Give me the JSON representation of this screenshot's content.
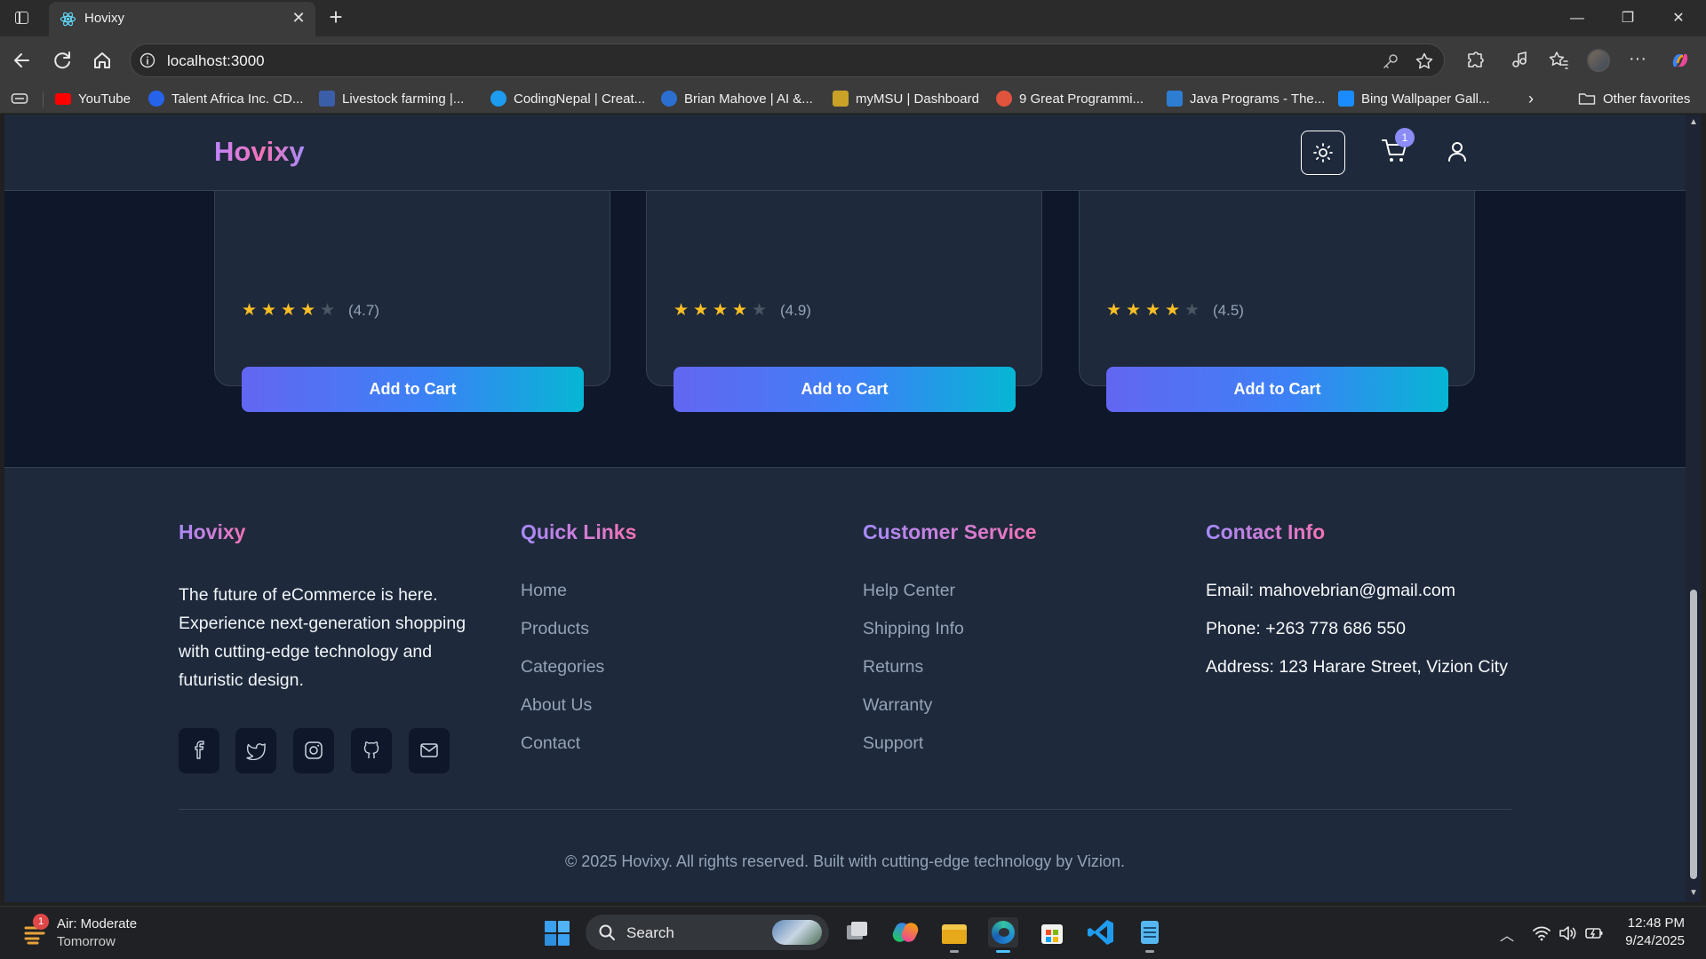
{
  "browser": {
    "tab_title": "Hovixy",
    "url": "localhost:3000",
    "window_controls": [
      "minimize",
      "restore",
      "close"
    ],
    "bookmarks": [
      {
        "label": "YouTube",
        "icon": "youtube-icon",
        "color": "#ff0000"
      },
      {
        "label": "Talent Africa Inc. CD...",
        "icon": "talent-africa-icon",
        "color": "#2563eb"
      },
      {
        "label": "Livestock farming |...",
        "icon": "livestock-icon",
        "color": "#3b5ea8"
      },
      {
        "label": "CodingNepal | Creat...",
        "icon": "codingnepal-icon",
        "color": "#1d9bf0"
      },
      {
        "label": "Brian Mahove | AI &...",
        "icon": "globe-icon",
        "color": "#2b6fd1"
      },
      {
        "label": "myMSU | Dashboard",
        "icon": "msu-icon",
        "color": "#c9a227"
      },
      {
        "label": "9 Great Programmi...",
        "icon": "programming-icon",
        "color": "#e0533c"
      },
      {
        "label": "Java Programs - The...",
        "icon": "java-icon",
        "color": "#2d7dd2"
      },
      {
        "label": "Bing Wallpaper Gall...",
        "icon": "bing-icon",
        "color": "#1a8cff"
      }
    ],
    "other_favorites": "Other favorites"
  },
  "site": {
    "brand": "Hovixy",
    "cart_count": "1",
    "products": [
      {
        "rating": "(4.7)",
        "stars": 4,
        "button": "Add to Cart"
      },
      {
        "rating": "(4.9)",
        "stars": 4,
        "button": "Add to Cart"
      },
      {
        "rating": "(4.5)",
        "stars": 4,
        "button": "Add to Cart"
      }
    ]
  },
  "footer": {
    "brand": "Hovixy",
    "description": "The future of eCommerce is here. Experience next-generation shopping with cutting-edge technology and futuristic design.",
    "quick_links_title": "Quick Links",
    "quick_links": [
      "Home",
      "Products",
      "Categories",
      "About Us",
      "Contact"
    ],
    "customer_service_title": "Customer Service",
    "customer_service": [
      "Help Center",
      "Shipping Info",
      "Returns",
      "Warranty",
      "Support"
    ],
    "contact_title": "Contact Info",
    "contact": {
      "email": "Email: mahovebrian@gmail.com",
      "phone": "Phone: +263 778 686 550",
      "address": "Address: 123 Harare Street, Vizion City"
    },
    "social_icons": [
      "facebook-icon",
      "twitter-icon",
      "instagram-icon",
      "github-icon",
      "mail-icon"
    ],
    "copyright": "© 2025 Hovixy. All rights reserved. Built with cutting-edge technology by Vizion."
  },
  "taskbar": {
    "weather_line1": "Air: Moderate",
    "weather_line2": "Tomorrow",
    "weather_badge": "1",
    "search_label": "Search",
    "time": "12:48 PM",
    "date": "9/24/2025"
  },
  "colors": {
    "page_bg": "#0f172a",
    "card_bg": "#1e293b",
    "button_gradient_start": "#6366f1",
    "button_gradient_end": "#06b6d4",
    "star": "#fbbf24",
    "brand_gradient": "#c084fc"
  }
}
